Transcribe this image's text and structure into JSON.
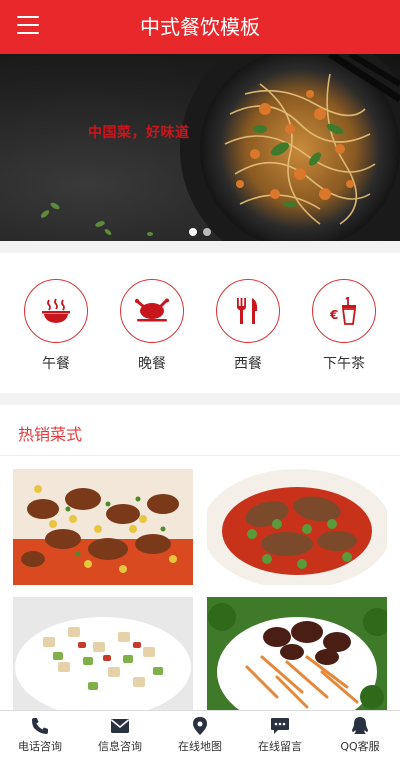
{
  "header": {
    "title": "中式餐饮模板"
  },
  "banner": {
    "caption": "中国菜，好味道",
    "slide_count": 2,
    "active_slide": 1
  },
  "categories": [
    {
      "label": "午餐",
      "icon": "rice-bowl-icon"
    },
    {
      "label": "晚餐",
      "icon": "roast-chicken-icon"
    },
    {
      "label": "西餐",
      "icon": "fork-knife-icon"
    },
    {
      "label": "下午茶",
      "icon": "coffee-cup-icon"
    }
  ],
  "hot_section": {
    "title": "热销菜式"
  },
  "bottom_nav": [
    {
      "label": "电话咨询",
      "icon": "phone-icon"
    },
    {
      "label": "信息咨询",
      "icon": "mail-icon"
    },
    {
      "label": "在线地图",
      "icon": "map-pin-icon"
    },
    {
      "label": "在线留言",
      "icon": "chat-bubble-icon"
    },
    {
      "label": "QQ客服",
      "icon": "qq-penguin-icon"
    }
  ],
  "colors": {
    "brand_red": "#e8282b",
    "accent_red": "#e4393c",
    "icon_red": "#c8161d",
    "nav_icon": "#2a3140"
  }
}
